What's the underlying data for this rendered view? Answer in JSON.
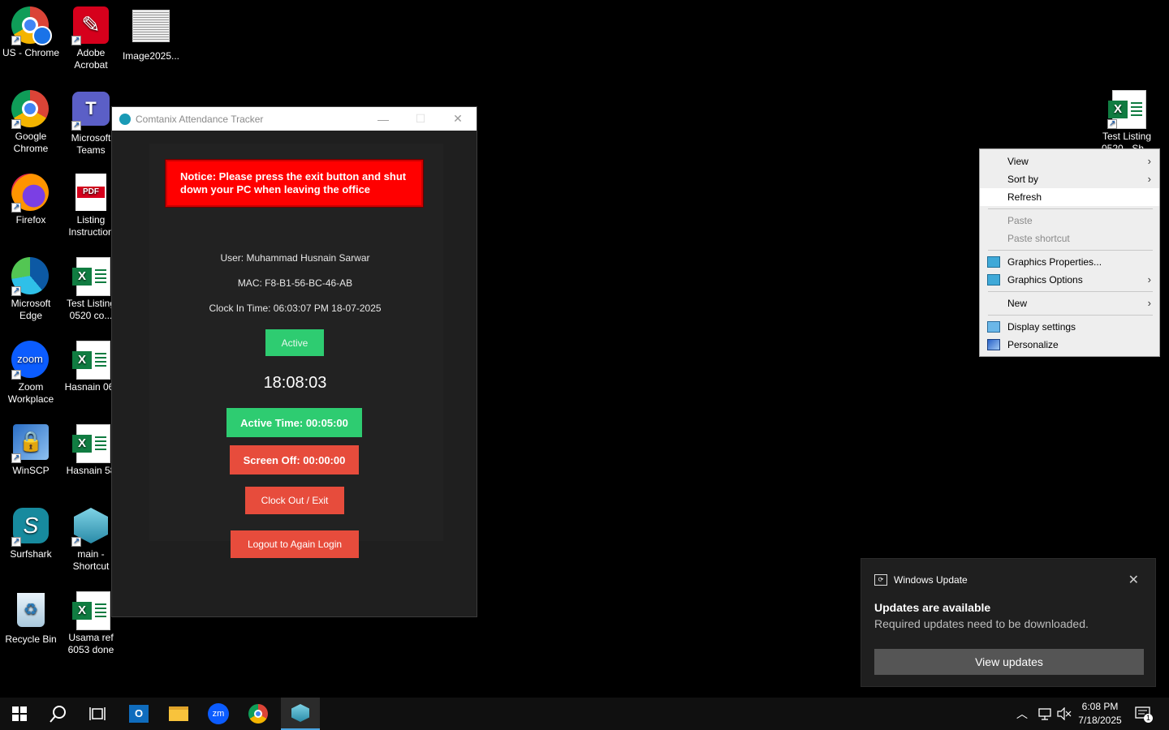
{
  "desktop": {
    "icons": [
      {
        "label": "US - Chrome"
      },
      {
        "label": "Adobe\nAcrobat"
      },
      {
        "label": "Image2025..."
      },
      {
        "label": "Google\nChrome"
      },
      {
        "label": "Microsoft\nTeams"
      },
      {
        "label": "Firefox"
      },
      {
        "label": "Listing\nInstruction"
      },
      {
        "label": "Microsoft\nEdge"
      },
      {
        "label": "Test Listing\n0520 co..."
      },
      {
        "label": "Zoom\nWorkplace"
      },
      {
        "label": "Hasnain 06("
      },
      {
        "label": "WinSCP"
      },
      {
        "label": "Hasnain 58"
      },
      {
        "label": "Surfshark"
      },
      {
        "label": "main -\nShortcut"
      },
      {
        "label": "Recycle Bin"
      },
      {
        "label": "Usama ref\n6053 done"
      },
      {
        "label": "Test Listing\n0520 - Sh..."
      }
    ]
  },
  "app": {
    "title": "Comtanix Attendance Tracker",
    "minimize": "—",
    "maximize": "☐",
    "close": "✕",
    "notice": "Notice: Please press the exit button and shut down your PC when leaving the office",
    "user": "User: Muhammad Husnain Sarwar",
    "mac": "MAC: F8-B1-56-BC-46-AB",
    "clock_in": "Clock In Time: 06:03:07 PM 18-07-2025",
    "status": "Active",
    "clock": "18:08:03",
    "active_time": "Active Time: 00:05:00",
    "screen_off": "Screen Off: 00:00:00",
    "clock_out": "Clock Out / Exit",
    "logout": "Logout to Again Login"
  },
  "context_menu": {
    "view": "View",
    "sort_by": "Sort by",
    "refresh": "Refresh",
    "paste": "Paste",
    "paste_shortcut": "Paste shortcut",
    "graphics_properties": "Graphics Properties...",
    "graphics_options": "Graphics Options",
    "new": "New",
    "display_settings": "Display settings",
    "personalize": "Personalize"
  },
  "toast": {
    "app": "Windows Update",
    "title": "Updates are available",
    "body": "Required updates need to be downloaded.",
    "button": "View updates",
    "close": "✕"
  },
  "taskbar": {
    "time": "6:08 PM",
    "date": "7/18/2025",
    "notification_count": "1"
  },
  "colors": {
    "green": "#2ecc71",
    "red": "#e74c3c",
    "notice_red": "#ff0000",
    "accent": "#4aa3df"
  }
}
